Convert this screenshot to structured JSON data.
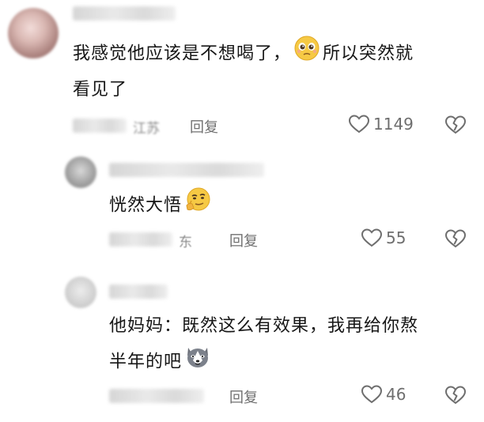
{
  "comments": [
    {
      "text_line1_a": "我感觉他应该是不想喝了，",
      "text_line1_b": "所以突然就",
      "text_line2": "看见了",
      "emoji": "pleading-face-emoji",
      "meta_visible": "江苏",
      "reply_label": "回复",
      "likes": "1149"
    },
    {
      "text": "恍然大悟",
      "emoji": "thinking-smirk-emoji",
      "meta_visible": "东",
      "reply_label": "回复",
      "likes": "55"
    },
    {
      "text_line1": "他妈妈：既然这么有效果，我再给你熬",
      "text_line2": "半年的吧",
      "emoji": "husky-dog-emoji",
      "reply_label": "回复",
      "likes": "46"
    }
  ],
  "colors": {
    "text": "#161616",
    "meta": "#8a8a8a",
    "icon": "#6e6e6e"
  }
}
